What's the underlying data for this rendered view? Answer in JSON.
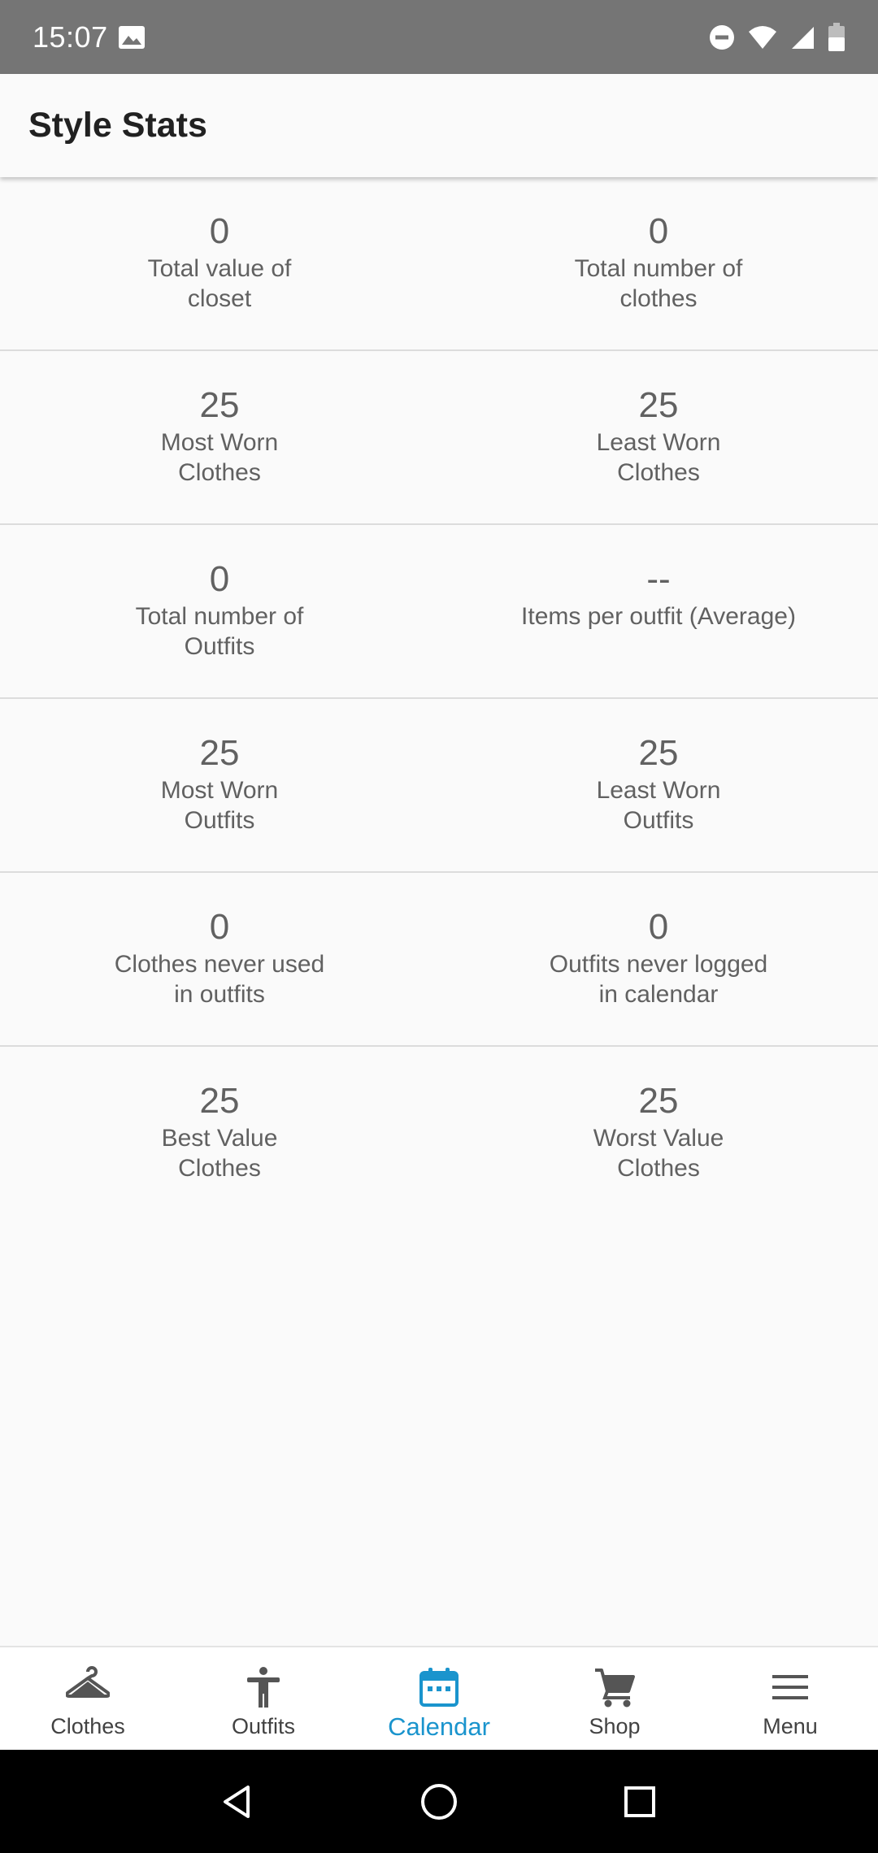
{
  "status_bar": {
    "time": "15:07"
  },
  "app_bar": {
    "title": "Style Stats"
  },
  "stats": [
    {
      "left": {
        "value": "0",
        "label": "Total value of\ncloset"
      },
      "right": {
        "value": "0",
        "label": "Total number of\nclothes"
      }
    },
    {
      "left": {
        "value": "25",
        "label": "Most Worn\nClothes"
      },
      "right": {
        "value": "25",
        "label": "Least Worn\nClothes"
      }
    },
    {
      "left": {
        "value": "0",
        "label": "Total number of\nOutfits"
      },
      "right": {
        "value": "--",
        "label": "Items per outfit (Average)"
      }
    },
    {
      "left": {
        "value": "25",
        "label": "Most Worn\nOutfits"
      },
      "right": {
        "value": "25",
        "label": "Least Worn\nOutfits"
      }
    },
    {
      "left": {
        "value": "0",
        "label": "Clothes never used\nin outfits"
      },
      "right": {
        "value": "0",
        "label": "Outfits never logged\nin calendar"
      }
    },
    {
      "left": {
        "value": "25",
        "label": "Best Value\nClothes"
      },
      "right": {
        "value": "25",
        "label": "Worst Value\nClothes"
      }
    }
  ],
  "bottom_nav": {
    "items": [
      {
        "label": "Clothes",
        "icon": "hanger-icon"
      },
      {
        "label": "Outfits",
        "icon": "person-icon"
      },
      {
        "label": "Calendar",
        "icon": "calendar-icon",
        "active": true
      },
      {
        "label": "Shop",
        "icon": "cart-icon"
      },
      {
        "label": "Menu",
        "icon": "menu-icon"
      }
    ]
  },
  "colors": {
    "accent": "#1a94cd",
    "status_bar": "#757575",
    "text_secondary": "#616161"
  }
}
